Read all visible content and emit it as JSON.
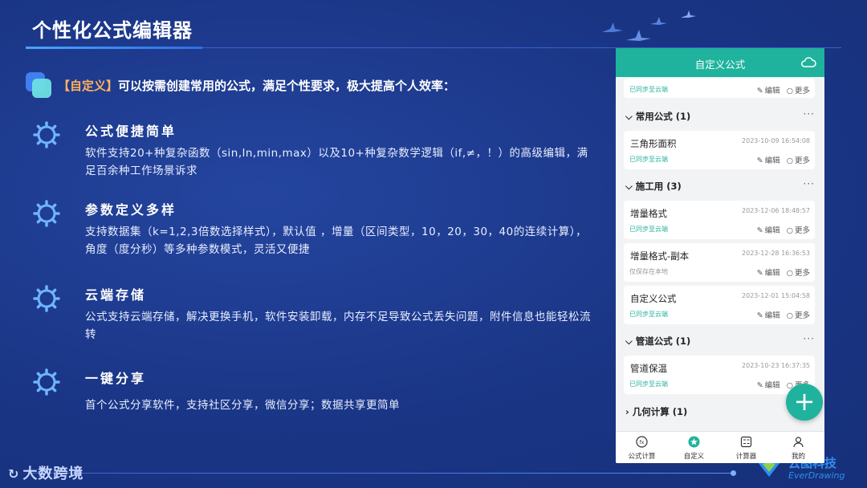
{
  "slide": {
    "title": "个性化公式编辑器",
    "intro_highlight": "【自定义】",
    "intro_text": "可以按需创建常用的公式，满足个性要求，极大提高个人效率：",
    "features": [
      {
        "title": "公式便捷简单",
        "desc": "软件支持20+种复杂函数（sin,ln,min,max）以及10+种复杂数学逻辑（if,≠，！）的高级编辑，满足百余种工作场景诉求"
      },
      {
        "title": "参数定义多样",
        "desc": "支持数据集（k=1,2,3倍数选择样式），默认值 ，增量（区间类型，10，20，30，40的连续计算），角度（度分秒）等多种参数模式，灵活又便捷"
      },
      {
        "title": "云端存储",
        "desc": "公式支持云端存储，解决更换手机，软件安装卸载，内存不足导致公式丢失问题，附件信息也能轻松流转"
      },
      {
        "title": "一键分享",
        "desc": "首个公式分享软件，支持社区分享，微信分享；数据共享更简单"
      }
    ],
    "brand_left": "大数跨境",
    "brand_right_cn": "云图科技",
    "brand_right_en": "EverDrawing"
  },
  "phone": {
    "header_title": "自定义公式",
    "edit_label": "编辑",
    "more_label": "更多",
    "synced_label": "已同步至云端",
    "local_label": "仅保存在本地",
    "groups": [
      {
        "name": "常用公式 (1)"
      },
      {
        "name": "施工用 (3)"
      },
      {
        "name": "管道公式 (1)"
      },
      {
        "name": "几何计算 (1)"
      }
    ],
    "items": [
      {
        "name": "三角形面积",
        "time": "2023-10-09 16:54:08"
      },
      {
        "name": "增量格式",
        "time": "2023-12-06 18:48:57"
      },
      {
        "name": "增量格式-副本",
        "time": "2023-12-28 16:36:53"
      },
      {
        "name": "自定义公式",
        "time": "2023-12-01 15:04:58"
      },
      {
        "name": "管道保温",
        "time": "2023-10-23 16:37:35"
      }
    ],
    "tabs": [
      "公式计算",
      "自定义",
      "计算器",
      "我的"
    ],
    "accent": "#1fb39d"
  }
}
